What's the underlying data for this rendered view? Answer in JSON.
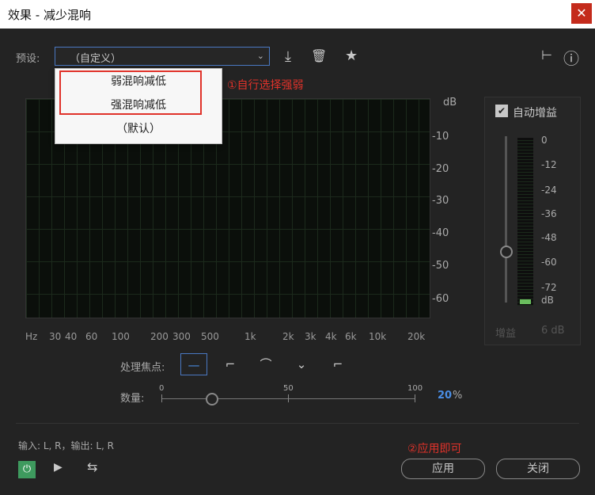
{
  "window": {
    "title": "效果 - 减少混响",
    "close": "✕"
  },
  "preset": {
    "label": "预设:",
    "value": "（自定义）",
    "arrow": "⌄"
  },
  "toolbar": {
    "save_icon": "⤓",
    "delete_icon": "🗑",
    "favorite_icon": "★",
    "routing_icon": "⊢",
    "info_icon": "ⓘ"
  },
  "dropdown": {
    "items": [
      "弱混响减低",
      "强混响减低",
      "（默认）"
    ]
  },
  "annotation1": "①自行选择强弱",
  "annotation2": "②应用即可",
  "graph": {
    "db_unit": "dB",
    "db_ticks": [
      "-10",
      "-20",
      "-30",
      "-40",
      "-50",
      "-60"
    ],
    "freq_labels": [
      "Hz",
      "30",
      "40",
      "60",
      "100",
      "200",
      "300",
      "500",
      "1k",
      "2k",
      "3k",
      "4k",
      "6k",
      "10k",
      "20k"
    ]
  },
  "gain": {
    "auto_label": "自动增益",
    "checked": true,
    "meter_ticks": [
      "0",
      "-12",
      "-24",
      "-36",
      "-48",
      "-60",
      "-72"
    ],
    "meter_unit": "dB",
    "gain_label": "增益",
    "gain_value": "6 dB",
    "meter_level": 0.03
  },
  "focus": {
    "label": "处理焦点:",
    "options": [
      "—",
      "⌐",
      "⌒",
      "⌄",
      "⌐"
    ]
  },
  "amount": {
    "label": "数量:",
    "min": "0",
    "mid": "50",
    "max": "100",
    "value": "20",
    "unit": "%"
  },
  "io": {
    "text": "输入: L, R，输出: L, R"
  },
  "buttons": {
    "apply": "应用",
    "close": "关闭",
    "power": "⏻",
    "play": "▶",
    "loop": "⇆"
  },
  "colors": {
    "accent": "#4a8ee6",
    "annotation": "#e0322a",
    "power": "#3e9a5e"
  }
}
